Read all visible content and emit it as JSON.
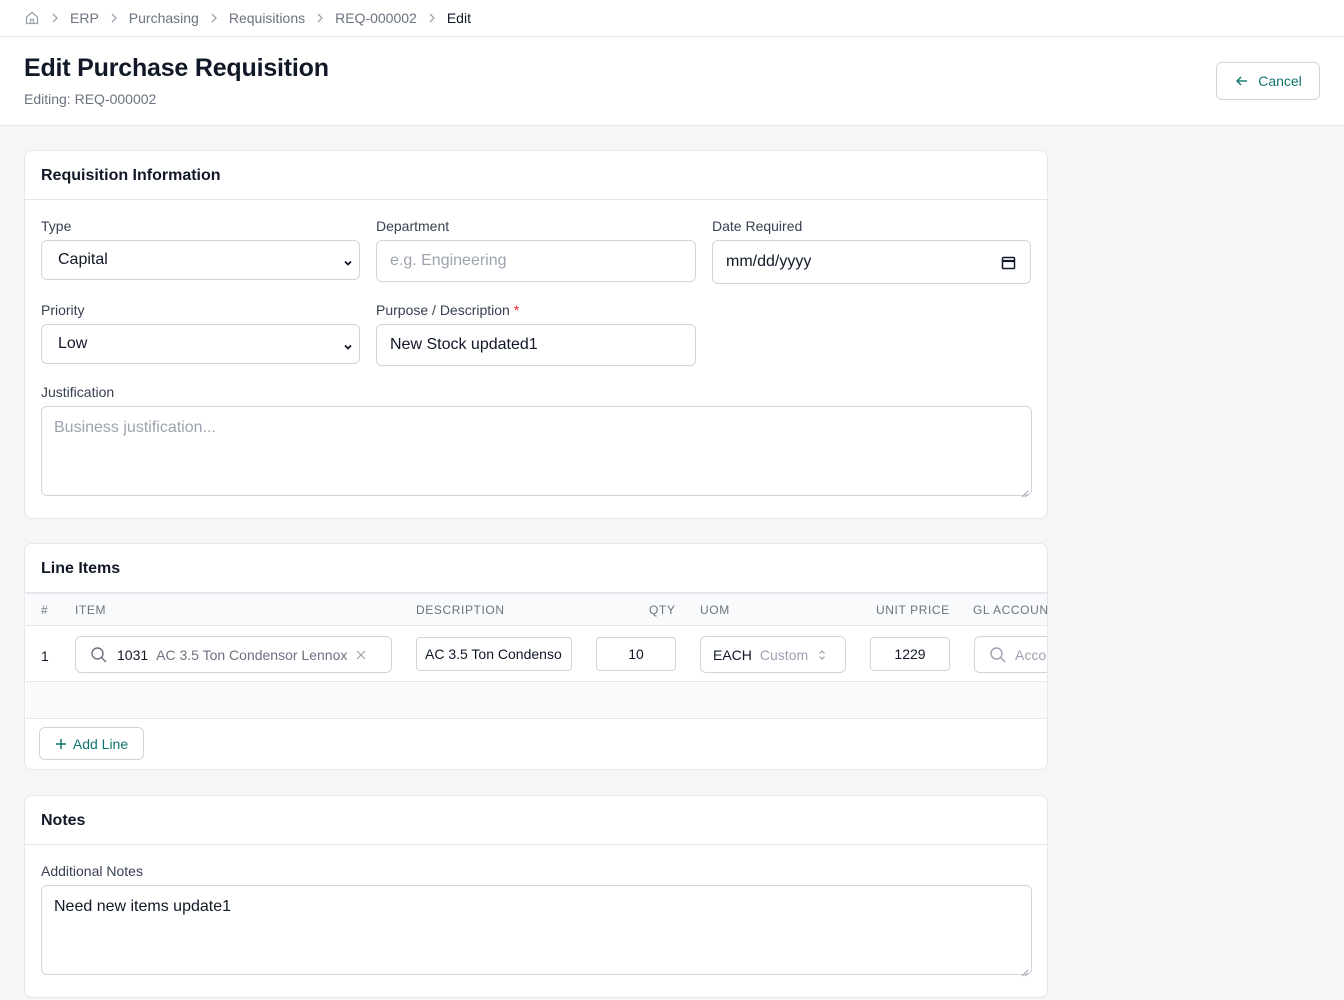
{
  "breadcrumb": {
    "items": [
      "ERP",
      "Purchasing",
      "Requisitions",
      "REQ-000002"
    ],
    "current": "Edit"
  },
  "header": {
    "title": "Edit Purchase Requisition",
    "subtitle": "Editing: REQ-000002",
    "cancel_label": "Cancel"
  },
  "requisition": {
    "section_title": "Requisition Information",
    "type": {
      "label": "Type",
      "value": "Capital"
    },
    "department": {
      "label": "Department",
      "placeholder": "e.g. Engineering",
      "value": ""
    },
    "date_required": {
      "label": "Date Required",
      "value": "mm/dd/yyyy"
    },
    "priority": {
      "label": "Priority",
      "value": "Low"
    },
    "purpose": {
      "label": "Purpose / Description",
      "required_mark": "*",
      "value": "New Stock updated1"
    },
    "justification": {
      "label": "Justification",
      "placeholder": "Business justification..."
    }
  },
  "line_items": {
    "section_title": "Line Items",
    "columns": [
      "#",
      "ITEM",
      "DESCRIPTION",
      "QTY",
      "UOM",
      "UNIT PRICE",
      "GL ACCOUN"
    ],
    "rows": [
      {
        "num": "1",
        "item_code": "1031",
        "item_name": "AC 3.5 Ton Condensor Lennox",
        "description": "AC 3.5 Ton Condenso",
        "qty": "10",
        "uom": "EACH",
        "uom_hint": "Custom",
        "unit_price": "1229",
        "gl_placeholder": "Acco"
      }
    ],
    "add_line_label": "Add Line"
  },
  "notes": {
    "section_title": "Notes",
    "label": "Additional Notes",
    "value": "Need new items update1"
  },
  "colors": {
    "accent": "#0f766e",
    "border": "#e5e7eb",
    "background": "#f5f6f8",
    "required": "#dc2626"
  }
}
